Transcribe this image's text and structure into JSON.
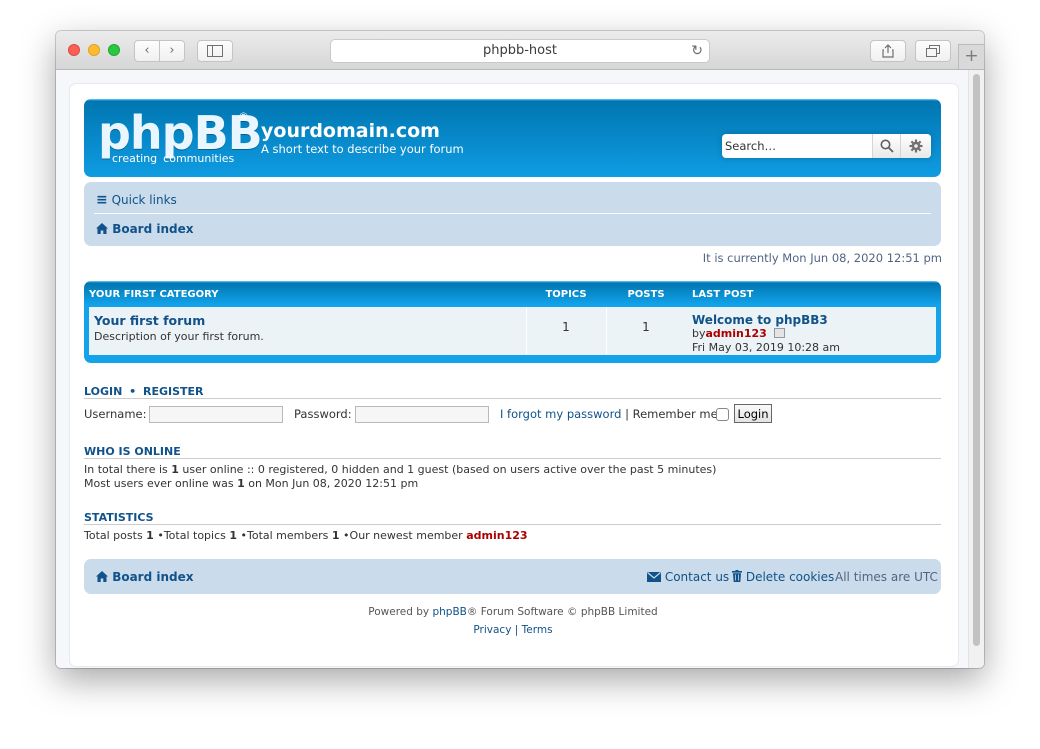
{
  "browser": {
    "url": "phpbb-host"
  },
  "header": {
    "logo_text": "phpBB",
    "logo_sub1": "creating",
    "logo_sub2": "communities",
    "site_title": "yourdomain.com",
    "site_desc": "A short text to describe your forum",
    "search_placeholder": "Search…"
  },
  "nav": {
    "quick_links": "Quick links",
    "board_index": "Board index"
  },
  "datetime": "It is currently Mon Jun 08, 2020 12:51 pm",
  "category": {
    "name": "YOUR FIRST CATEGORY",
    "col_topics": "TOPICS",
    "col_posts": "POSTS",
    "col_last_post": "LAST POST",
    "forum": {
      "name": "Your first forum",
      "description": "Description of your first forum.",
      "topics": "1",
      "posts": "1",
      "last_post_title": "Welcome to phpBB3",
      "last_post_by_prefix": "by",
      "last_post_author": "admin123",
      "last_post_date": "Fri May 03, 2019 10:28 am"
    }
  },
  "login": {
    "login_label": "LOGIN",
    "sep": "•",
    "register_label": "REGISTER",
    "username_label": "Username:",
    "password_label": "Password:",
    "forgot": "I forgot my password",
    "pipe": "|",
    "remember": "Remember me",
    "button": "Login"
  },
  "online": {
    "title": "WHO IS ONLINE",
    "line1_a": "In total there is ",
    "line1_n": "1",
    "line1_b": " user online :: 0 registered, 0 hidden and 1 guest (based on users active over the past 5 minutes)",
    "line2_a": "Most users ever online was ",
    "line2_n": "1",
    "line2_b": " on Mon Jun 08, 2020 12:51 pm"
  },
  "stats": {
    "title": "STATISTICS",
    "posts_label": "Total posts ",
    "posts": "1",
    "topics_label": " •Total topics ",
    "topics": "1",
    "members_label": " •Total members ",
    "members": "1",
    "newest_label": " •Our newest member ",
    "newest": "admin123"
  },
  "footer": {
    "board_index": "Board index",
    "contact": "Contact us",
    "delete_cookies": "Delete cookies",
    "timezone": "All times are UTC",
    "powered_a": "Powered by ",
    "powered_link": "phpBB",
    "powered_b": "® Forum Software © phpBB Limited",
    "privacy": "Privacy",
    "pipe": "|",
    "terms": "Terms"
  },
  "colors": {
    "header_blue": "#12a3eb",
    "nav_bg": "#cadceb",
    "link": "#105289",
    "username_red": "#aa0000"
  }
}
